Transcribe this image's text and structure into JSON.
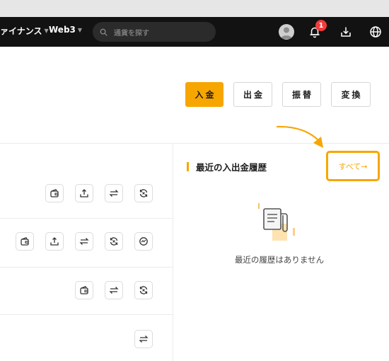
{
  "nav": {
    "finance_label": "ァイナンス",
    "web3_label": "Web3",
    "search_placeholder": "通貨を探す",
    "notification_count": "1"
  },
  "actions": {
    "deposit": "入金",
    "withdraw": "出金",
    "transfer": "振替",
    "convert": "変換"
  },
  "recent": {
    "title": "最近の入出金履歴",
    "view_all": "すべて→",
    "empty": "最近の履歴はありません"
  },
  "colors": {
    "accent": "#f7a600",
    "topbar": "#121212",
    "badge": "#f23b3b"
  },
  "asset_row_icons": [
    [
      "deposit-icon",
      "withdraw-icon",
      "transfer-icon",
      "convert-icon"
    ],
    [
      "deposit-icon",
      "withdraw-icon",
      "transfer-icon",
      "convert-icon",
      "trade-icon"
    ],
    [
      "deposit-icon",
      "transfer-icon",
      "convert-icon"
    ],
    [
      "transfer-icon"
    ]
  ]
}
